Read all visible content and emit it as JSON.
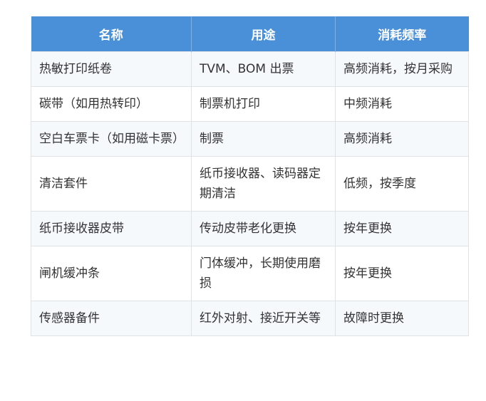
{
  "table": {
    "headers": [
      "名称",
      "用途",
      "消耗频率"
    ],
    "rows": [
      [
        "热敏打印纸卷",
        "TVM、BOM 出票",
        "高频消耗，按月采购"
      ],
      [
        "碳带（如用热转印）",
        "制票机打印",
        "中频消耗"
      ],
      [
        "空白车票卡（如用磁卡票）",
        "制票",
        "高频消耗"
      ],
      [
        "清洁套件",
        "纸币接收器、读码器定期清洁",
        "低频，按季度"
      ],
      [
        "纸币接收器皮带",
        "传动皮带老化更换",
        "按年更换"
      ],
      [
        "闸机缓冲条",
        "门体缓冲，长期使用磨损",
        "按年更换"
      ],
      [
        "传感器备件",
        "红外对射、接近开关等",
        "故障时更换"
      ]
    ]
  },
  "colors": {
    "header_bg": "#4a90d9",
    "header_text": "#ffffff",
    "row_alt_bg": "#f6f9fc",
    "border": "#dfe3e8",
    "text": "#333333"
  }
}
